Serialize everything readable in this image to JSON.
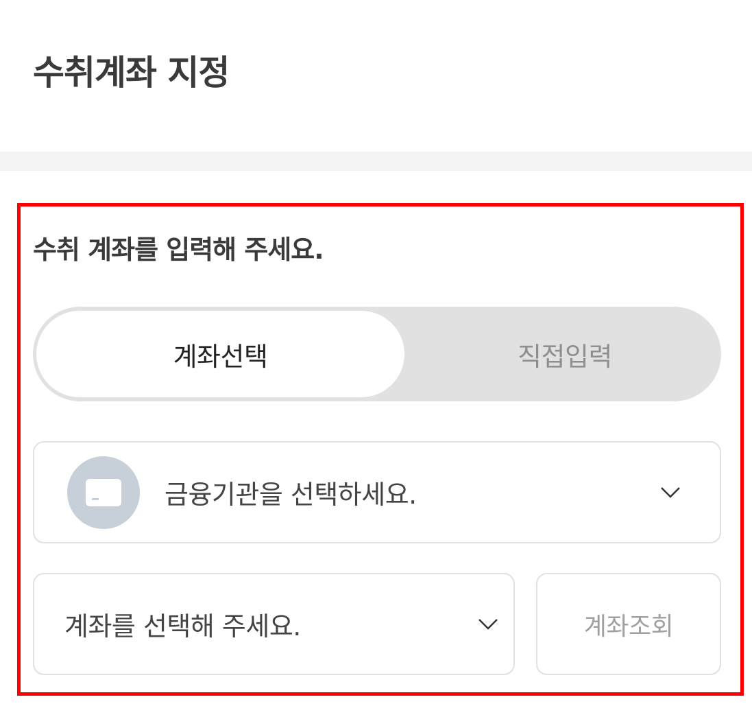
{
  "page": {
    "title": "수취계좌 지정"
  },
  "section": {
    "heading": "수취 계좌를 입력해 주세요."
  },
  "toggle": {
    "options": [
      {
        "label": "계좌선택",
        "selected": true
      },
      {
        "label": "직접입력",
        "selected": false
      }
    ]
  },
  "bank_select": {
    "icon": "bank-card-icon",
    "placeholder": "금융기관을 선택하세요.",
    "chevron_icon": "chevron-down-icon"
  },
  "account_select": {
    "placeholder": "계좌를 선택해 주세요.",
    "chevron_icon": "chevron-down-icon"
  },
  "lookup_button": {
    "label": "계좌조회"
  },
  "colors": {
    "highlight_border": "#ff0000",
    "segment_background": "#e1e1e1",
    "bank_icon_circle": "#c7cfd9",
    "disabled_text": "#a0a0a0"
  }
}
